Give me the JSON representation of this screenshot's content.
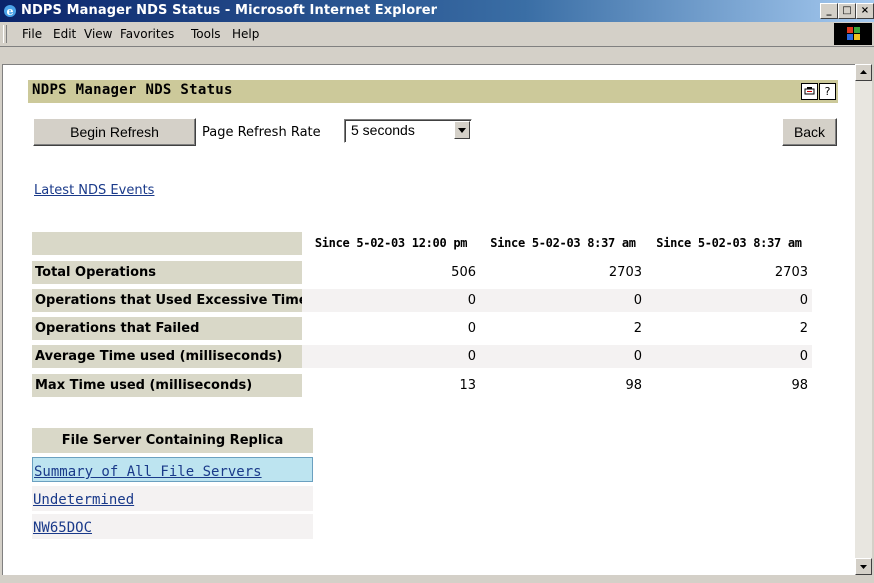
{
  "window": {
    "title": "NDPS Manager NDS Status - Microsoft Internet Explorer",
    "controls": {
      "minimize": "_",
      "maximize": "□",
      "close": "×"
    }
  },
  "menu": {
    "items": [
      {
        "label": "File"
      },
      {
        "label": "Edit"
      },
      {
        "label": "View"
      },
      {
        "label": "Favorites"
      },
      {
        "label": "Tools"
      },
      {
        "label": "Help"
      }
    ]
  },
  "page": {
    "header_title": "NDPS Manager NDS Status",
    "help_icon": "?",
    "begin_refresh_label": "Begin Refresh",
    "refresh_rate_label": "Page Refresh Rate",
    "refresh_rate_value": "5 seconds",
    "back_label": "Back",
    "latest_events_link": "Latest NDS Events"
  },
  "stats_table": {
    "columns": [
      "Since 5-02-03 12:00 pm",
      "Since 5-02-03 8:37 am",
      "Since 5-02-03 8:37 am"
    ],
    "rows": [
      {
        "label": "Total Operations",
        "values": [
          "506",
          "2703",
          "2703"
        ]
      },
      {
        "label": "Operations that Used Excessive Time",
        "values": [
          "0",
          "0",
          "0"
        ]
      },
      {
        "label": "Operations that Failed",
        "values": [
          "0",
          "2",
          "2"
        ]
      },
      {
        "label": "Average Time used (milliseconds)",
        "values": [
          "0",
          "0",
          "0"
        ]
      },
      {
        "label": "Max Time used (milliseconds)",
        "values": [
          "13",
          "98",
          "98"
        ]
      }
    ]
  },
  "file_servers": {
    "header": "File Server Containing Replica",
    "items": [
      {
        "label": "Summary of All File Servers Accessed"
      },
      {
        "label": "Undetermined"
      },
      {
        "label": "NW65DOC"
      }
    ]
  },
  "colors": {
    "header_bar": "#ccc99a",
    "label_cell": "#d9d8c8",
    "row_alt": "#f4f2f2",
    "selected_row": "#bde4f0",
    "link": "#1a3a8a"
  }
}
